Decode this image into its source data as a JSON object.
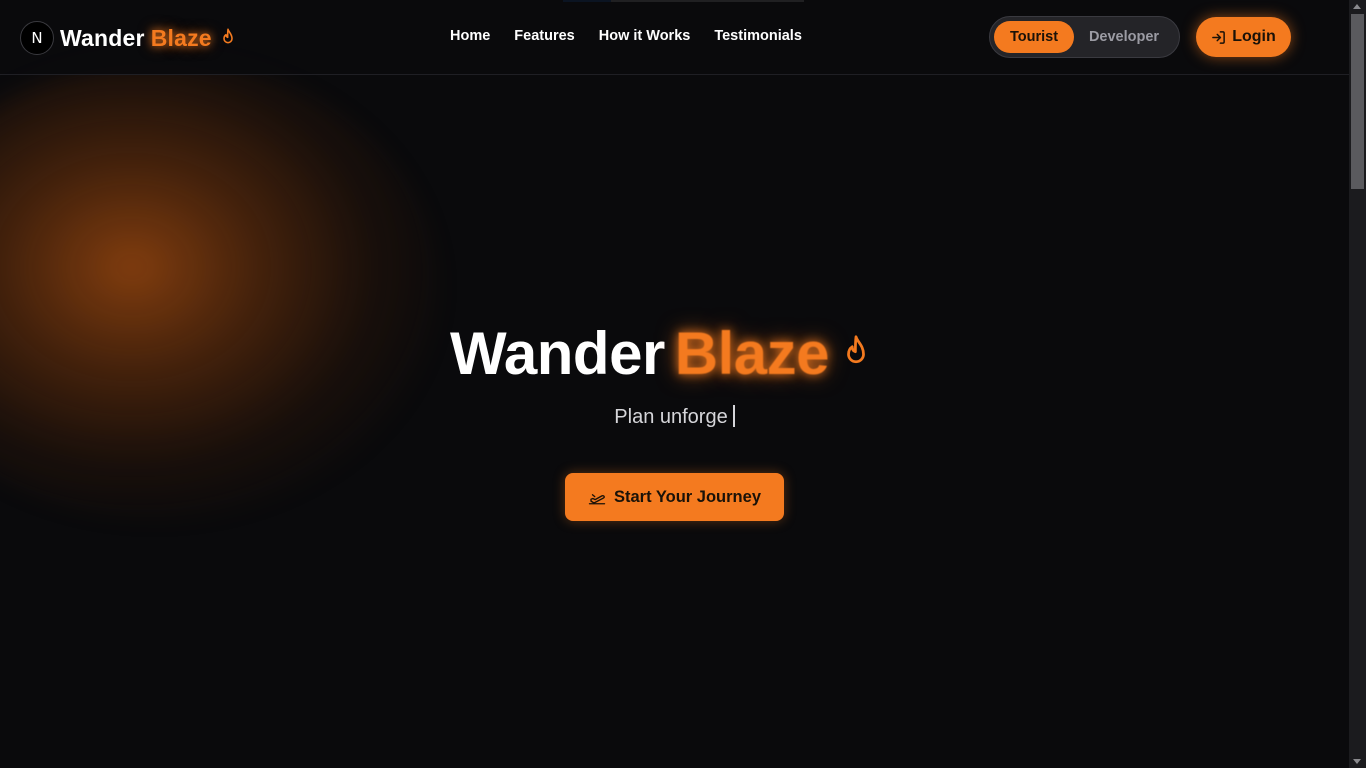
{
  "brand": {
    "badge": "N",
    "name_primary": "Wander",
    "name_accent": "Blaze",
    "logo_icon": "flame-icon"
  },
  "nav": {
    "items": [
      {
        "label": "Home"
      },
      {
        "label": "Features"
      },
      {
        "label": "How it Works"
      },
      {
        "label": "Testimonials"
      }
    ]
  },
  "role_toggle": {
    "options": [
      "Tourist",
      "Developer"
    ],
    "selected": "Tourist"
  },
  "login": {
    "label": "Login",
    "icon": "login-icon"
  },
  "hero": {
    "title_primary": "Wander",
    "title_accent": "Blaze",
    "title_icon": "flame-icon",
    "subtitle_typed": "Plan unforge",
    "cta_label": "Start Your Journey",
    "cta_icon": "plane-departure-icon"
  },
  "colors": {
    "accent": "#f47a1f",
    "background": "#0a0a0c",
    "text": "#ffffff",
    "muted": "#9b9ba3"
  }
}
